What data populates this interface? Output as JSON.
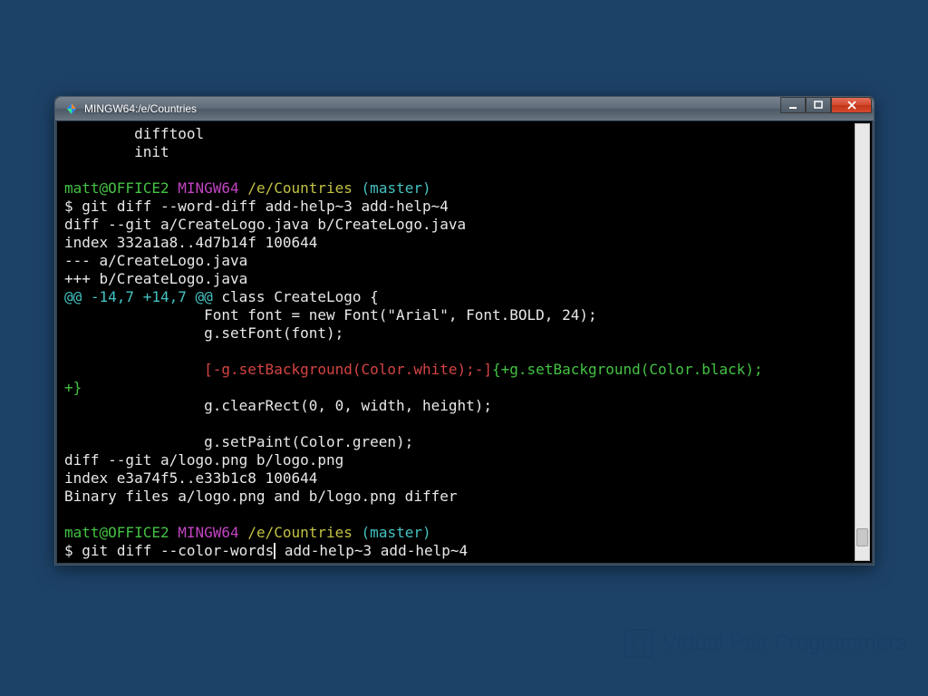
{
  "window": {
    "title": "MINGW64:/e/Countries"
  },
  "prompt": {
    "user": "matt@OFFICE2",
    "env": "MINGW64",
    "path": "/e/Countries",
    "branch": "(master)",
    "dollar": "$"
  },
  "lines": {
    "difftool": "        difftool",
    "init": "        init",
    "cmd1": "git diff --word-diff add-help~3 add-help~4",
    "diff_header1": "diff --git a/CreateLogo.java b/CreateLogo.java",
    "index1": "index 332a1a8..4d7b14f 100644",
    "filea": "--- a/CreateLogo.java",
    "fileb": "+++ b/CreateLogo.java",
    "hunk_prefix": "@@ -14,7 +14,7 @@",
    "hunk_rest": " class CreateLogo {",
    "ctx1": "                Font font = new Font(\"Arial\", Font.BOLD, 24);",
    "ctx2": "                g.setFont(font);",
    "removed": "[-g.setBackground(Color.white);-]",
    "added": "{+g.setBackground(Color.black);",
    "added2": "+}",
    "ctx3": "                g.clearRect(0, 0, width, height);",
    "ctx4": "                g.setPaint(Color.green);",
    "diff_header2": "diff --git a/logo.png b/logo.png",
    "index2": "index e3a74f5..e33b1c8 100644",
    "binary": "Binary files a/logo.png and b/logo.png differ",
    "cmd2a": "git diff --color-words",
    "cmd2b": " add-help~3 add-help~4"
  },
  "watermark": {
    "brand1": "Virtual Pair ",
    "brand2": "Programmers"
  }
}
